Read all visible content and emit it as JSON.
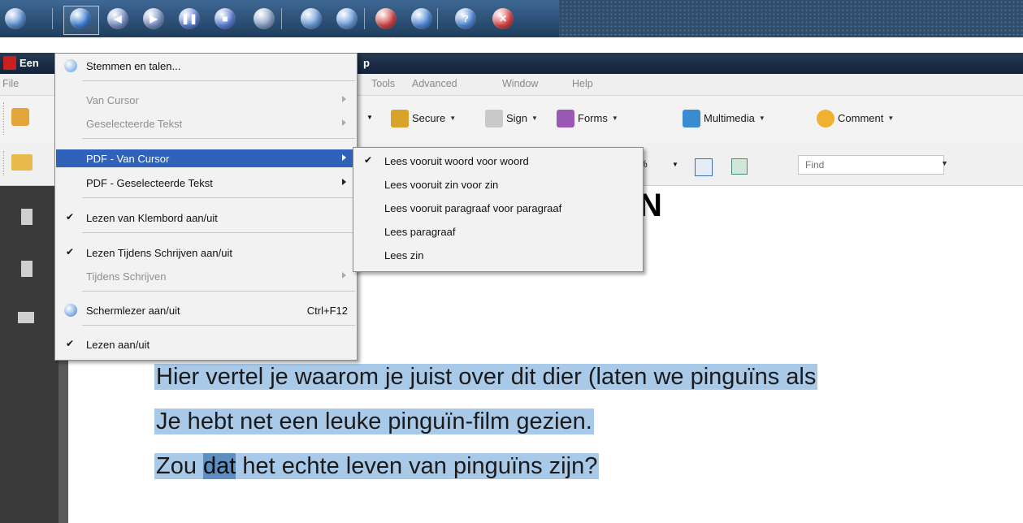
{
  "colors": {
    "menu_highlight": "#2f62b8",
    "text_highlight": "#a8c9e8",
    "current_word_highlight": "#5d8fc2",
    "speech_bar": "#2e4d6b"
  },
  "speech_toolbar": {
    "buttons": [
      {
        "icon": "app-menu-icon",
        "color": "#5a8ed0"
      },
      {
        "icon": "speech-options-icon",
        "color": "#3f7fd0"
      },
      {
        "icon": "previous-icon",
        "color": "#7c93c6",
        "glyph": "◀"
      },
      {
        "icon": "next-icon",
        "color": "#7c93c6",
        "glyph": "▶"
      },
      {
        "icon": "pause-icon",
        "color": "#5d7fd6",
        "glyph": "❚❚"
      },
      {
        "icon": "stop-icon",
        "color": "#5d7fd6",
        "glyph": "■"
      },
      {
        "icon": "read-from-cursor-icon",
        "color": "#8aa2c6"
      },
      {
        "icon": "dictionary-icon",
        "color": "#6a9ad8"
      },
      {
        "icon": "record-icon",
        "color": "#6a9ad8"
      },
      {
        "icon": "word-prediction-icon",
        "color": "#d04848"
      },
      {
        "icon": "highlighter-icon",
        "color": "#4f8ad6"
      },
      {
        "icon": "help-icon",
        "color": "#4f8ad6",
        "glyph": "?"
      },
      {
        "icon": "close-icon",
        "color": "#d84848",
        "glyph": "✕"
      }
    ]
  },
  "window": {
    "title_start": "Een",
    "title_end": "p"
  },
  "menubar": {
    "file": "File",
    "tools": "Tools",
    "advanced": "Advanced",
    "window": "Window",
    "help": "Help"
  },
  "toolbar": {
    "secure": "Secure",
    "sign": "Sign",
    "forms": "Forms",
    "multimedia": "Multimedia",
    "comment": "Comment"
  },
  "toolbar2": {
    "zoom_suffix": "%",
    "find_placeholder": "Find"
  },
  "main_menu": {
    "items": [
      {
        "label": "Stemmen en talen...",
        "state": "enabled",
        "icon": "voices-icon"
      },
      {
        "label": "Van Cursor",
        "state": "disabled",
        "submenu": true
      },
      {
        "label": "Geselecteerde Tekst",
        "state": "disabled",
        "submenu": true
      },
      {
        "label": "PDF - Van Cursor",
        "state": "hover",
        "submenu": true
      },
      {
        "label": "PDF - Geselecteerde Tekst",
        "state": "enabled",
        "submenu": true
      },
      {
        "label": "Lezen van Klembord aan/uit",
        "state": "checked"
      },
      {
        "label": "Lezen Tijdens Schrijven aan/uit",
        "state": "checked"
      },
      {
        "label": "Tijdens Schrijven",
        "state": "disabled",
        "submenu": true
      },
      {
        "label": "Schermlezer aan/uit",
        "state": "enabled",
        "icon": "screenreader-icon",
        "shortcut": "Ctrl+F12"
      },
      {
        "label": "Lezen aan/uit",
        "state": "checked"
      }
    ]
  },
  "submenu": {
    "items": [
      {
        "label": "Lees vooruit woord voor woord",
        "checked": true
      },
      {
        "label": "Lees vooruit zin voor zin",
        "checked": false
      },
      {
        "label": "Lees vooruit paragraaf voor paragraaf",
        "checked": false
      },
      {
        "label": "Lees paragraaf",
        "checked": false
      },
      {
        "label": "Lees zin",
        "checked": false
      }
    ]
  },
  "document": {
    "heading_fragment": "N",
    "lines": [
      {
        "text": "Hier vertel je waarom je juist over dit dier (laten we pinguïns als"
      },
      {
        "text": "Je hebt net een leuke pinguïn-film gezien."
      },
      {
        "before": "Zou ",
        "current_word": "dat",
        "after": " het echte leven van pinguïns zijn?"
      }
    ]
  }
}
